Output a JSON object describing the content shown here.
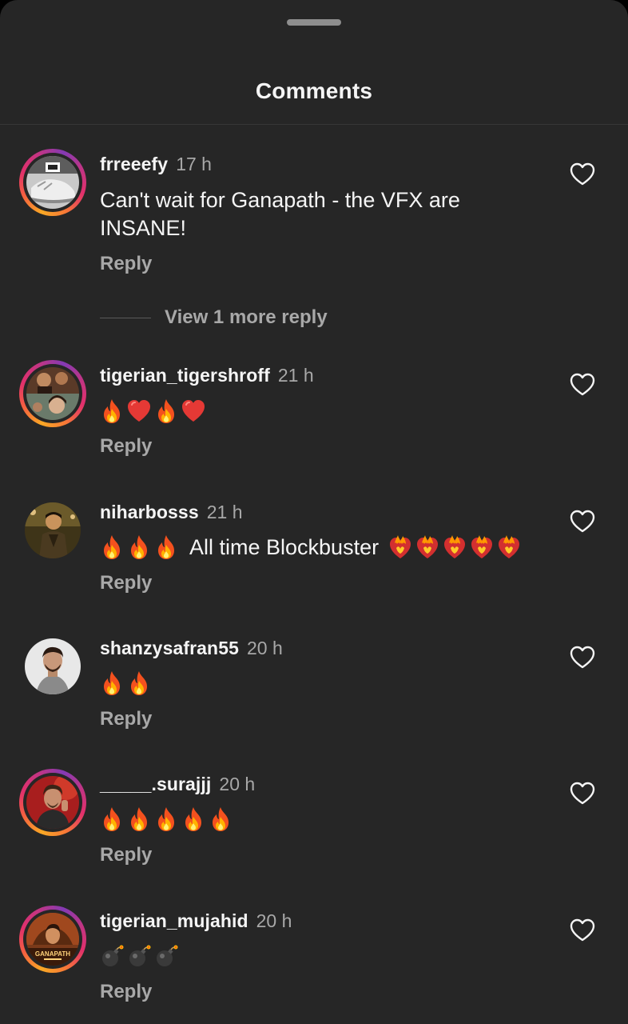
{
  "sheet": {
    "title": "Comments"
  },
  "comments": [
    {
      "username": "frreeefy",
      "time": "17 h",
      "text": "Can't wait for Ganapath - the VFX are INSANE!",
      "reply_label": "Reply",
      "view_more_label": "View 1 more reply",
      "avatar_icon": "sneaker-avatar"
    },
    {
      "username": "tigerian_tigershroff",
      "time": "21 h",
      "emojis": [
        "fire-icon",
        "red-heart-icon",
        "fire-icon",
        "red-heart-icon"
      ],
      "reply_label": "Reply",
      "avatar_icon": "movie-collage-avatar"
    },
    {
      "username": "niharbosss",
      "time": "21 h",
      "emojis_before": [
        "fire-icon",
        "fire-icon",
        "fire-icon"
      ],
      "text": "All time Blockbuster",
      "emojis_after": [
        "heart-on-fire-icon",
        "heart-on-fire-icon",
        "heart-on-fire-icon",
        "heart-on-fire-icon",
        "heart-on-fire-icon"
      ],
      "reply_label": "Reply",
      "avatar_icon": "man-action-avatar"
    },
    {
      "username": "shanzysafran55",
      "time": "20 h",
      "emojis": [
        "fire-icon",
        "fire-icon"
      ],
      "reply_label": "Reply",
      "avatar_icon": "man-portrait-avatar"
    },
    {
      "username": "_____.surajjj",
      "time": "20 h",
      "emojis": [
        "fire-icon",
        "fire-icon",
        "fire-icon",
        "fire-icon",
        "fire-icon"
      ],
      "reply_label": "Reply",
      "avatar_icon": "man-red-bg-avatar"
    },
    {
      "username": "tigerian_mujahid",
      "time": "20 h",
      "emojis": [
        "bomb-icon",
        "bomb-icon",
        "bomb-icon"
      ],
      "reply_label": "Reply",
      "avatar_icon": "ganapath-poster-avatar",
      "avatar_logo_text": "GANAPATH"
    }
  ],
  "colors": {
    "background": "#262626",
    "text_primary": "#f5f5f5",
    "text_secondary": "#a8a8a8",
    "story_ring_start": "#f9a825",
    "story_ring_end": "#c13584"
  }
}
